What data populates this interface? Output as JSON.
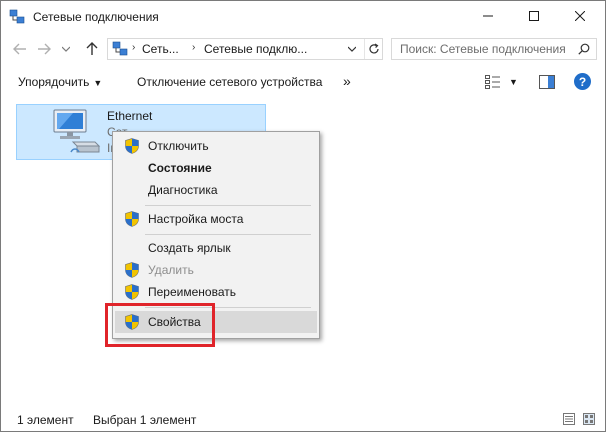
{
  "window": {
    "title": "Сетевые подключения"
  },
  "address": {
    "crumbs": [
      "Сеть...",
      "Сетевые подклю..."
    ],
    "search_placeholder": "Поиск: Сетевые подключения"
  },
  "commandbar": {
    "organize_label": "Упорядочить",
    "disable_label": "Отключение сетевого устройства",
    "more_label": "»"
  },
  "item": {
    "name": "Ethernet",
    "line2": "Сет",
    "line3": "Int"
  },
  "context_menu": {
    "items": [
      {
        "label": "Отключить",
        "shield": true,
        "bold": false,
        "disabled": false
      },
      {
        "label": "Состояние",
        "shield": false,
        "bold": true,
        "disabled": false
      },
      {
        "label": "Диагностика",
        "shield": false,
        "bold": false,
        "disabled": false
      },
      {
        "label": "Настройка моста",
        "shield": true,
        "bold": false,
        "disabled": false
      },
      {
        "label": "Создать ярлык",
        "shield": false,
        "bold": false,
        "disabled": false
      },
      {
        "label": "Удалить",
        "shield": true,
        "bold": false,
        "disabled": true
      },
      {
        "label": "Переименовать",
        "shield": true,
        "bold": false,
        "disabled": false
      },
      {
        "label": "Свойства",
        "shield": true,
        "bold": false,
        "disabled": false,
        "highlighted": true
      }
    ]
  },
  "statusbar": {
    "count": "1 элемент",
    "selected": "Выбран 1 элемент"
  },
  "colors": {
    "selection": "#cce8ff",
    "highlight_frame": "#e0242a",
    "help": "#1f6dc9"
  }
}
